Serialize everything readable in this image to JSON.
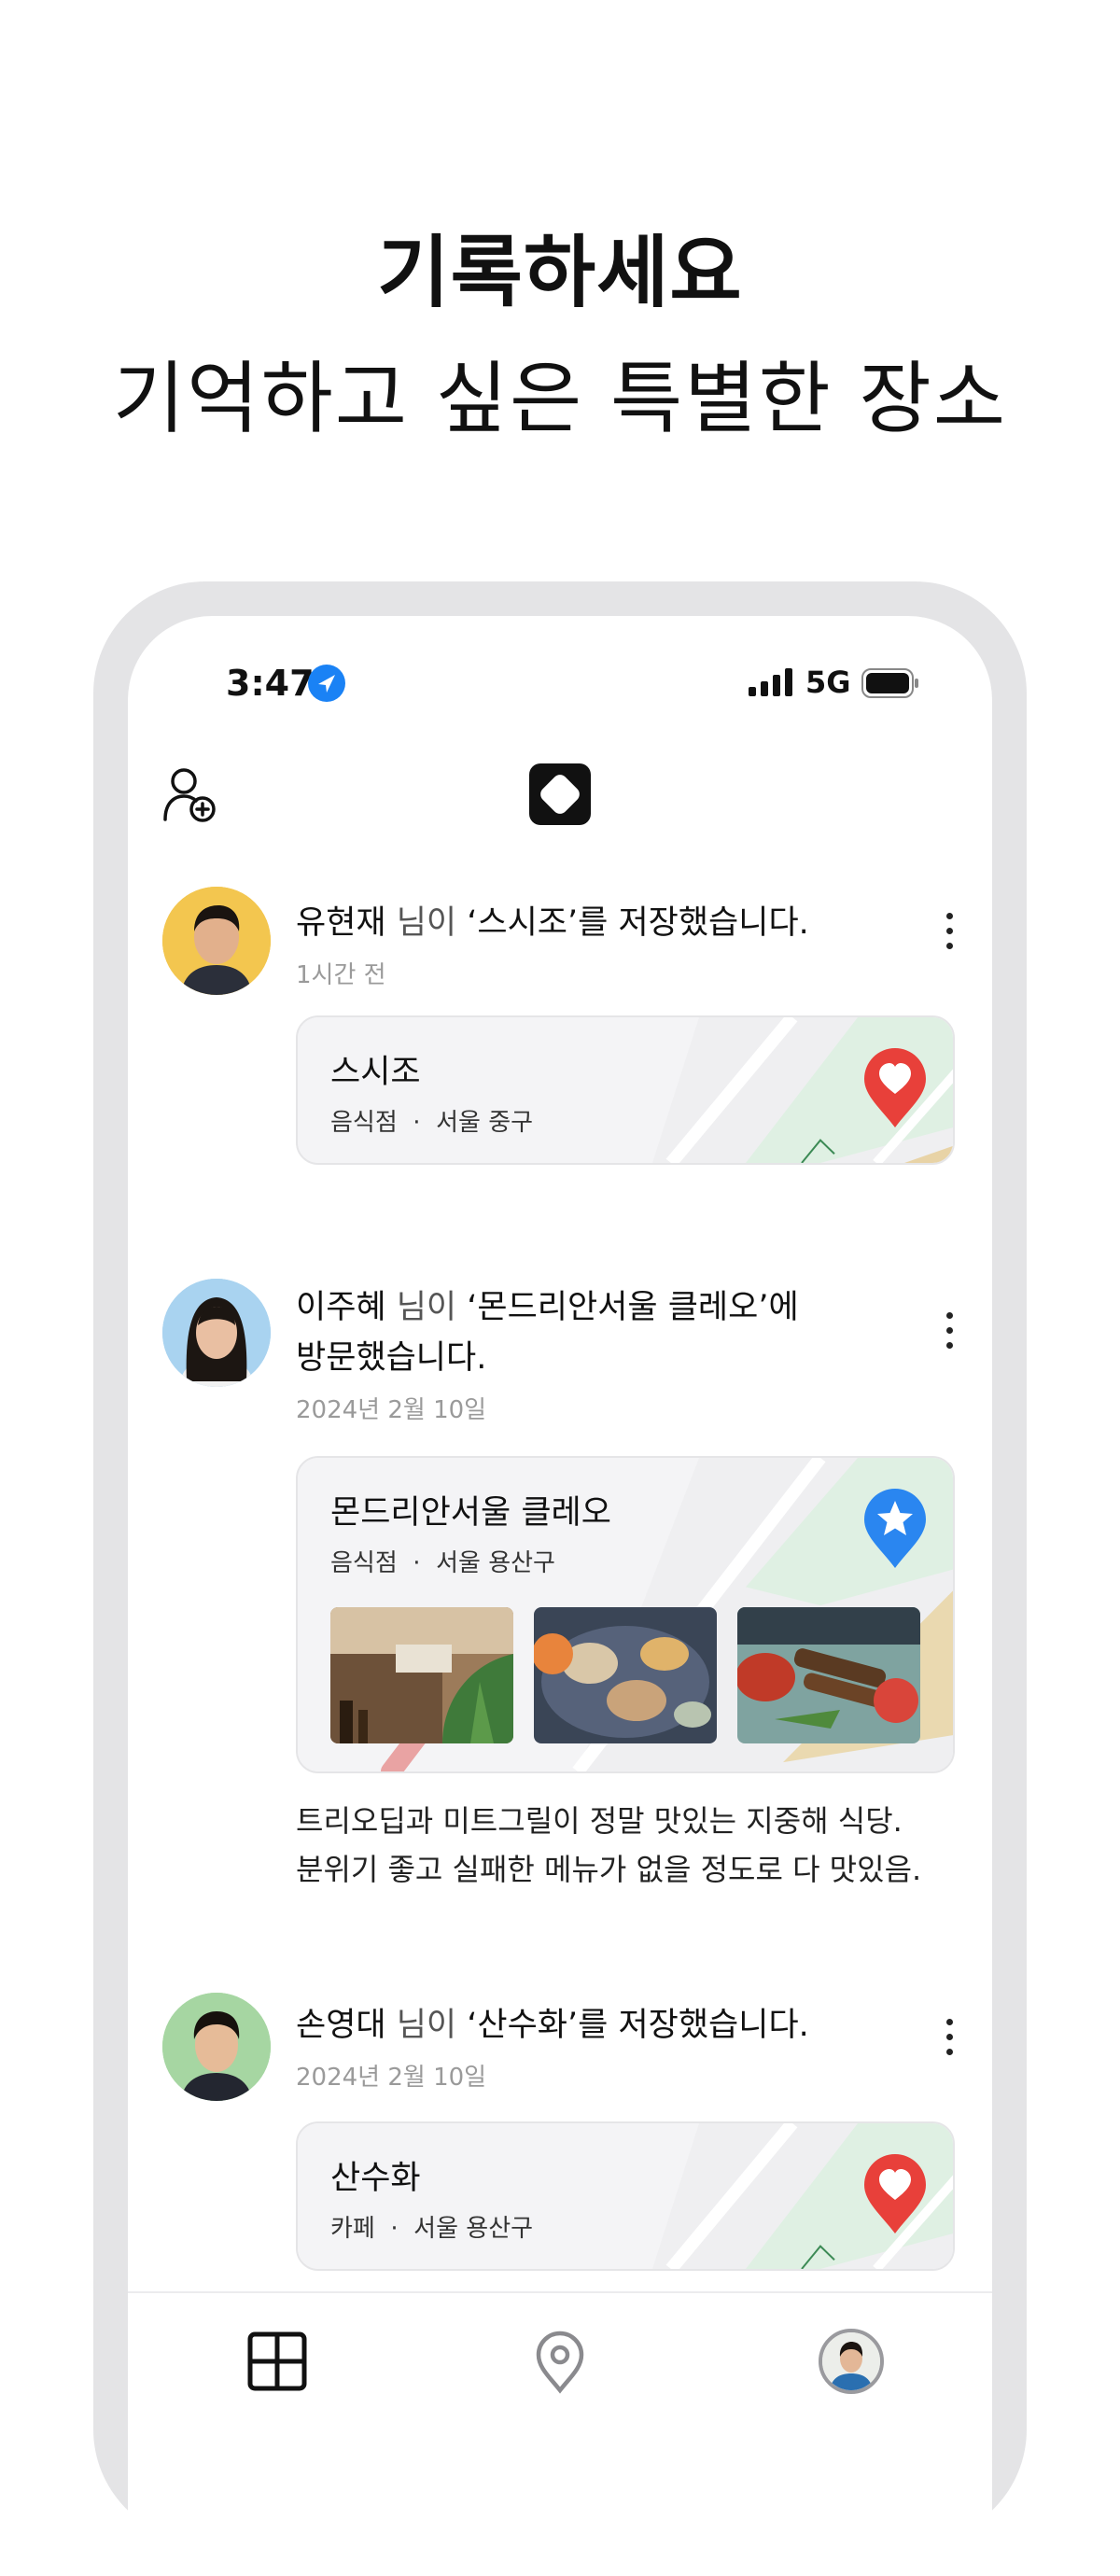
{
  "hero": {
    "title": "기록하세요",
    "subtitle": "기억하고 싶은 특별한 장소"
  },
  "status_bar": {
    "time": "3:47",
    "network": "5G",
    "icons": [
      "location-arrow-icon",
      "signal-icon",
      "battery-icon"
    ]
  },
  "header": {
    "left_icon": "add-friend-icon",
    "logo": "app-logo"
  },
  "feed": [
    {
      "user": "유현재",
      "activity_prefix": " 님이 ",
      "activity_place": "‘스시조’",
      "activity_suffix": "를 저장했습니다.",
      "time": "1시간 전",
      "card": {
        "name": "스시조",
        "meta": "음식점  ·  서울 중구",
        "pin": "heart-pin-icon",
        "pin_color": "#e8403a"
      }
    },
    {
      "user": "이주혜",
      "activity_prefix": " 님이 ",
      "activity_place": "‘몬드리안서울 클레오’",
      "activity_suffix": "에",
      "activity_line2": "방문했습니다.",
      "time": "2024년 2월 10일",
      "card": {
        "name": "몬드리안서울 클레오",
        "meta": "음식점  ·  서울 용산구",
        "pin": "star-pin-icon",
        "pin_color": "#2a86f0",
        "photos": [
          "restaurant-interior-photo",
          "seafood-platter-photo",
          "grilled-meat-platter-photo"
        ]
      },
      "comment_line1": "트리오딥과 미트그릴이 정말 맛있는 지중해 식당.",
      "comment_line2": "분위기 좋고 실패한 메뉴가 없을 정도로 다 맛있음."
    },
    {
      "user": "손영대",
      "activity_prefix": " 님이 ",
      "activity_place": "‘산수화’",
      "activity_suffix": "를 저장했습니다.",
      "time": "2024년 2월 10일",
      "card": {
        "name": "산수화",
        "meta": "카페  ·  서울 용산구",
        "pin": "heart-pin-icon",
        "pin_color": "#e8403a"
      }
    }
  ],
  "tab_bar": {
    "tabs": [
      "feed-grid-icon",
      "map-pin-icon",
      "profile-avatar"
    ]
  },
  "colors": {
    "frame": "#e4e4e6",
    "secondary_text": "#9a9a9a",
    "accent_blue": "#1a82f5"
  }
}
